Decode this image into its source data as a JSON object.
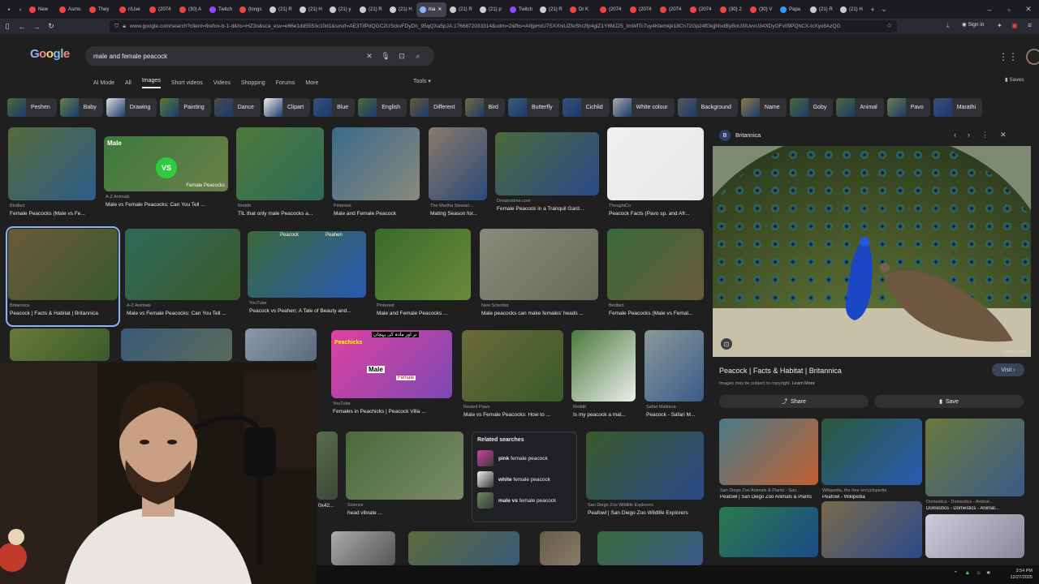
{
  "browser": {
    "tabs": [
      {
        "label": "New",
        "color": "#e44"
      },
      {
        "label": "Asmo",
        "color": "#e44"
      },
      {
        "label": "They",
        "color": "#e44"
      },
      {
        "label": "r/Live",
        "color": "#e44"
      },
      {
        "label": "(2074",
        "color": "#e44"
      },
      {
        "label": "(30) A",
        "color": "#e44"
      },
      {
        "label": "Twitch",
        "color": "#9146ff"
      },
      {
        "label": "(longs",
        "color": "#e44"
      },
      {
        "label": "(21) R",
        "color": "#ccc"
      },
      {
        "label": "(21) H",
        "color": "#ccc"
      },
      {
        "label": "(21) y",
        "color": "#ccc"
      },
      {
        "label": "(21) R",
        "color": "#ccc"
      },
      {
        "label": "(21) H",
        "color": "#ccc"
      },
      {
        "label": "ma",
        "color": "#8ab4f8",
        "active": true
      },
      {
        "label": "(21) R",
        "color": "#ccc"
      },
      {
        "label": "(21) p",
        "color": "#ccc"
      },
      {
        "label": "Twitch",
        "color": "#9146ff"
      },
      {
        "label": "(21) R",
        "color": "#ccc"
      },
      {
        "label": "Dr K",
        "color": "#e44"
      },
      {
        "label": "(2074",
        "color": "#e44"
      },
      {
        "label": "(2074",
        "color": "#e44"
      },
      {
        "label": "(2074",
        "color": "#e44"
      },
      {
        "label": "(2074",
        "color": "#e44"
      },
      {
        "label": "(30) 2",
        "color": "#e44"
      },
      {
        "label": "(30) V",
        "color": "#e44"
      },
      {
        "label": "Papa",
        "color": "#39f"
      },
      {
        "label": "(21) R",
        "color": "#ccc"
      },
      {
        "label": "(21) H",
        "color": "#ccc"
      }
    ],
    "url": "www.google.com/search?client=firefox-b-1-d&hs=HZ3o&sca_esv=e66e1dd5553c10d1&sxsrf=AE3TifPdQGC2USckvFDyDh_95qQXa5pJA:1766872033314&udm=2&fbs=AIIjpHxU7SXXniUZfeShr2fp4giZ1Y6MJ25_tmWlTc7uy4Klemkjk18Cn72Gp24fGkjjhfxdByBoU3IUvvU34XDyOFvIf9PQhCX-tcXyx8AzQG",
    "signin": "Sign in"
  },
  "google": {
    "logo": "Google",
    "query": "male and female peacock",
    "tabs": [
      "AI Mode",
      "All",
      "Images",
      "Short videos",
      "Videos",
      "Shopping",
      "Forums",
      "More"
    ],
    "tools": "Tools",
    "saves": "Saves"
  },
  "chips": [
    "Peshen",
    "Baby",
    "Drawing",
    "Painting",
    "Dance",
    "Clipart",
    "Blue",
    "English",
    "Different",
    "Bird",
    "Butterfly",
    "Cichlid",
    "White colour",
    "Background",
    "Name",
    "Goby",
    "Animal",
    "Pavo",
    "Marathi"
  ],
  "results": [
    {
      "src": "Birdfact",
      "cap": "Female Peacocks (Male vs Fe..."
    },
    {
      "src": "A-Z Animals",
      "cap": "Male vs Female Peacocks: Can You Tell ..."
    },
    {
      "src": "Reddit",
      "cap": "TIL that only male Peacocks a..."
    },
    {
      "src": "Pinterest",
      "cap": "Male and Female Peacock"
    },
    {
      "src": "The Martha Stewart...",
      "cap": "Mating Season for..."
    },
    {
      "src": "Dreamstime.com",
      "cap": "Female Peacock in a Tranquil Gard..."
    },
    {
      "src": "ThoughtCo",
      "cap": "Peacock Facts (Pavo sp. and Afr..."
    },
    {
      "src": "Britannica",
      "cap": "Peacock | Facts & Habitat | Britannica"
    },
    {
      "src": "A-Z Animals",
      "cap": "Male vs Female Peacocks: Can You Tell ..."
    },
    {
      "src": "YouTube",
      "cap": "Peacock vs Peahen: A Tale of Beauty and..."
    },
    {
      "src": "Pinterest",
      "cap": "Male and Female Peacocks ..."
    },
    {
      "src": "New Scientist",
      "cap": "Male peacocks can make females' heads ..."
    },
    {
      "src": "Birdfact",
      "cap": "Female Peacocks (Male vs Femal..."
    },
    {
      "src": "YouTube",
      "cap": "Females in Peachicks | Peacock Villa ..."
    },
    {
      "src": "Rested Paws",
      "cap": "Male vs Female Peacocks: How to ..."
    },
    {
      "src": "Reddit",
      "cap": "Is my peacock a mal..."
    },
    {
      "src": "Safari Mallorca",
      "cap": "Peacock - Safari M..."
    },
    {
      "src": "Science",
      "cap": "head vibrate ..."
    },
    {
      "src": "San Diego Zoo Wildlife Explorers",
      "cap": "Peafowl | San Diego Zoo Wildlife Explorers"
    },
    {
      "src": "",
      "cap": "0x42..."
    }
  ],
  "thumb_text": {
    "male": "Male",
    "vs": "VS",
    "female": "Female Peacocks",
    "peacock": "Peacock",
    "peahen": "Peahen",
    "peachicks": "Peachicks",
    "urdu": "نر اور مادہ کی پہچان",
    "male2": "Male",
    "female2": "Female"
  },
  "related": {
    "title": "Related searches",
    "items": [
      {
        "bold": "pink",
        "rest": " female peacock"
      },
      {
        "bold": "white",
        "rest": " female peacock"
      },
      {
        "bold": "male vs",
        "rest": " female peacock"
      }
    ]
  },
  "panel": {
    "site": "Britannica",
    "title": "Peacock | Facts & Habitat | Britannica",
    "note": "Images may be subject to copyright.",
    "learn_more": "Learn More",
    "visit": "Visit",
    "share": "Share",
    "save": "Save",
    "dims": "1,600 × 1,060",
    "more": [
      {
        "src": "San Diego Zoo Animals & Plants - San...",
        "cap": "Peafowl | San Diego Zoo Animals & Plants"
      },
      {
        "src": "Wikipedia, the free encyclopedia",
        "cap": "Peafowl - Wikipedia"
      },
      {
        "src": "Domestics - Domestics - Animal...",
        "cap": "Domestics - Domestics - Animal..."
      }
    ]
  },
  "taskbar": {
    "time": "3:54 PM",
    "date": "12/27/2025"
  }
}
